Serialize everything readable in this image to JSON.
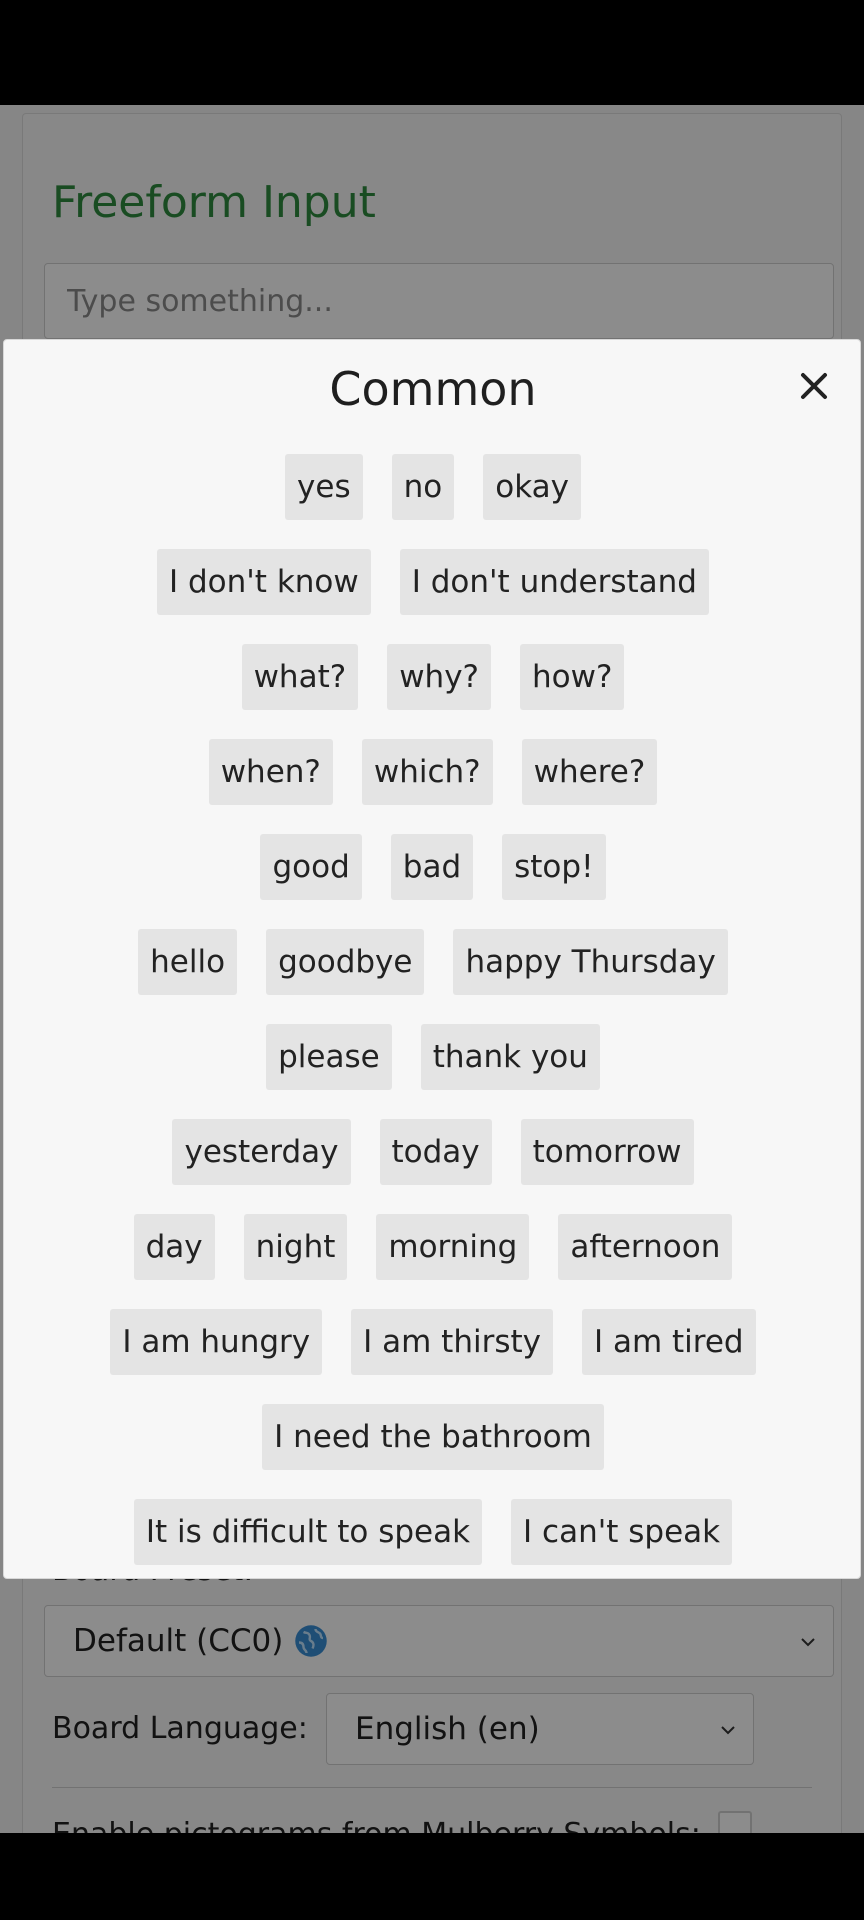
{
  "freeform": {
    "title": "Freeform Input",
    "placeholder": "Type something..."
  },
  "settings": {
    "board_preset_label": "Board Preset:",
    "board_preset_value": "Default (CC0)",
    "board_language_label": "Board Language:",
    "board_language_value": "English (en)",
    "pictograms_label": "Enable pictograms from Mulberry Symbols:"
  },
  "modal": {
    "title": "Common",
    "close_glyph": "✕",
    "rows": [
      [
        "yes",
        "no",
        "okay"
      ],
      [
        "I don't know",
        "I don't understand"
      ],
      [
        "what?",
        "why?",
        "how?"
      ],
      [
        "when?",
        "which?",
        "where?"
      ],
      [
        "good",
        "bad",
        "stop!"
      ],
      [
        "hello",
        "goodbye",
        "happy Thursday"
      ],
      [
        "please",
        "thank you"
      ],
      [
        "yesterday",
        "today",
        "tomorrow"
      ],
      [
        "day",
        "night",
        "morning",
        "afternoon"
      ],
      [
        "I am hungry",
        "I am thirsty",
        "I am tired"
      ],
      [
        "I need the bathroom"
      ],
      [
        "It is difficult to speak",
        "I can't speak"
      ]
    ]
  },
  "icons": {
    "close": "close-icon",
    "globe": "globe-icon",
    "chevron": "chevron-down-icon"
  },
  "colors": {
    "accent_green": "#2e8b3e",
    "button_bg": "#e4e4e4"
  }
}
